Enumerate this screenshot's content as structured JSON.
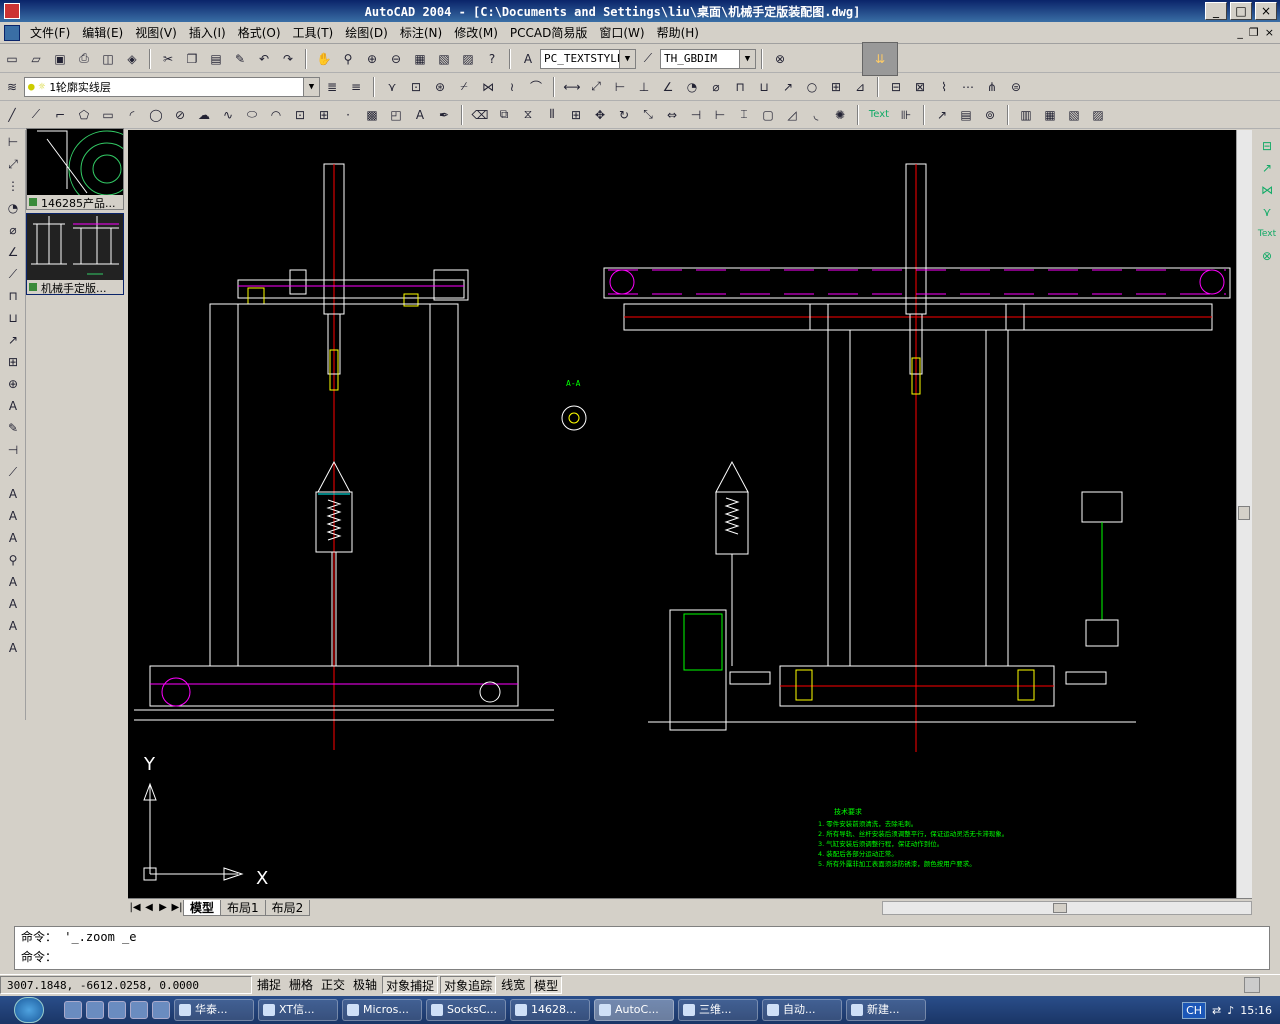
{
  "window": {
    "title": "AutoCAD 2004 - [C:\\Documents and Settings\\liu\\桌面\\机械手定版装配图.dwg]",
    "minimize": "_",
    "maximize": "□",
    "close": "×"
  },
  "menu": [
    "文件(F)",
    "编辑(E)",
    "视图(V)",
    "插入(I)",
    "格式(O)",
    "工具(T)",
    "绘图(D)",
    "标注(N)",
    "修改(M)",
    "PCCAD简易版",
    "窗口(W)",
    "帮助(H)"
  ],
  "mdi_controls": [
    "_",
    "❐",
    "×"
  ],
  "toolbar": {
    "text_style": "PC_TEXTSTYLE",
    "dim_style": "TH_GBDIM",
    "layer": "1轮廓实线层"
  },
  "thumbnails": [
    {
      "label": "146285产品..."
    },
    {
      "label": "机械手定版..."
    }
  ],
  "right_toolbar_text_label": "Text",
  "annotation_text_label": "Text",
  "axis_labels": {
    "x": "X",
    "y": "Y"
  },
  "section_label": "A-A",
  "tech_notes": {
    "title": "技术要求",
    "lines": [
      "1. 零件安装前须清洗，去除毛刺。",
      "2. 所有导轨、丝杆安装后须调整平行，保证运动灵活无卡滞现象。",
      "3. 气缸安装后须调整行程，保证动作到位。",
      "4. 装配后各部分运动正常。",
      "5. 所有外露非加工表面须涂防锈漆，颜色按用户要求。"
    ]
  },
  "layout_tabs": [
    "模型",
    "布局1",
    "布局2"
  ],
  "command_lines": [
    "命令： '_.zoom _e",
    "命令："
  ],
  "status": {
    "coords": "3007.1848, -6612.0258, 0.0000",
    "modes": [
      {
        "label": "捕捉",
        "on": false
      },
      {
        "label": "栅格",
        "on": false
      },
      {
        "label": "正交",
        "on": false
      },
      {
        "label": "极轴",
        "on": false
      },
      {
        "label": "对象捕捉",
        "on": true
      },
      {
        "label": "对象追踪",
        "on": true
      },
      {
        "label": "线宽",
        "on": false
      },
      {
        "label": "模型",
        "on": true
      }
    ]
  },
  "taskbar": {
    "tasks": [
      "华泰...",
      "XT信...",
      "Micros...",
      "SocksC...",
      "14628...",
      "AutoC...",
      "三维...",
      "自动...",
      "新建..."
    ],
    "active_task": "AutoC...",
    "lang": "CH",
    "clock": "15:16"
  },
  "colors": {
    "canvas": "#000000",
    "line_white": "#ffffff",
    "line_magenta": "#ff00ff",
    "line_red": "#ff0000",
    "line_yellow": "#ffff00",
    "line_green": "#00ff00",
    "line_cyan": "#00ffff"
  }
}
